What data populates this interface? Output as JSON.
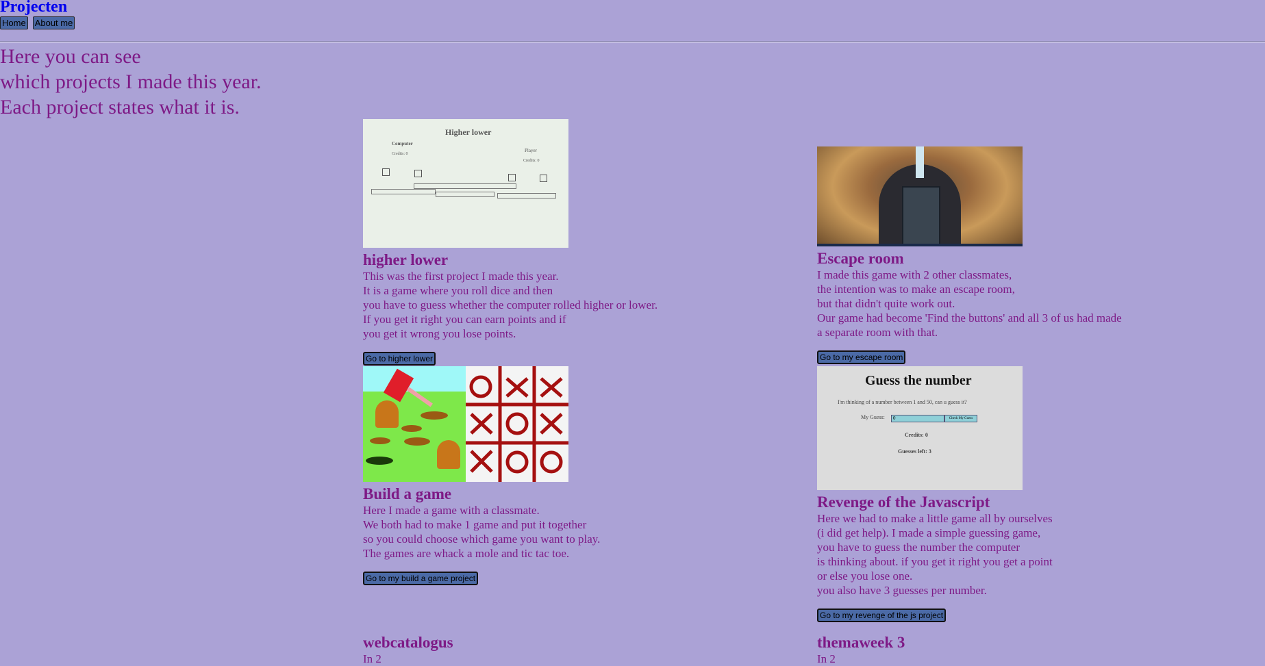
{
  "header": {
    "title": "Projecten",
    "nav": [
      {
        "label": "Home"
      },
      {
        "label": "About me"
      }
    ]
  },
  "intro": {
    "lines": [
      "Here you can see",
      "which projects I made this year.",
      "Each project states what it is."
    ]
  },
  "projects": [
    {
      "title": "higher lower",
      "thumb": {
        "heading": "Higher lower",
        "computer_label": "Computer",
        "computer_credits": "Credits: 0",
        "player_label": "Player",
        "player_credits": "Credits: 0"
      },
      "description": [
        "This was the first project I made this year.",
        "It is a game where you roll dice and then",
        "you have to guess whether the computer rolled higher or lower.",
        "If you get it right you can earn points and if",
        "you get it wrong you lose points."
      ],
      "button": "Go to higher lower"
    },
    {
      "title": "Escape room",
      "description": [
        "I made this game with 2 other classmates,",
        "the intention was to make an escape room,",
        "but that didn't quite work out.",
        "Our game had become 'Find the buttons' and all 3 of us had made",
        "a separate room with that."
      ],
      "button": "Go to my escape room"
    },
    {
      "title": "Build a game",
      "description": [
        "Here I made a game with a classmate.",
        "We both had to make 1 game and put it together",
        "so you could choose which game you want to play.",
        "The games are whack a mole and tic tac toe."
      ],
      "button": "Go to my build a game project"
    },
    {
      "title": "Revenge of the Javascript",
      "thumb": {
        "heading": "Guess the number",
        "prompt": "I'm thinking of a number between 1 and 50, can u guess it?",
        "guess_label": "My Guess:",
        "guess_value": "0",
        "check_label": "Check My Guess",
        "credits": "Credits: 0",
        "guesses_left": "Guesses left: 3"
      },
      "description": [
        "Here we had to make a little game all by ourselves",
        "(i did get help). I made a simple guessing game,",
        "you have to guess the number the computer",
        "is thinking about. if you get it right you get a point",
        "or else you lose one.",
        "you also have 3 guesses per number."
      ],
      "button": "Go to my revenge of the js project"
    },
    {
      "title": "webcatalogus",
      "subtitle": "In 2"
    },
    {
      "title": "themaweek 3",
      "subtitle": "In 2"
    }
  ],
  "colors": {
    "background": "#aba2d6",
    "text": "#7e1a86",
    "link": "#0000ee",
    "button": "#4b6aa6"
  }
}
